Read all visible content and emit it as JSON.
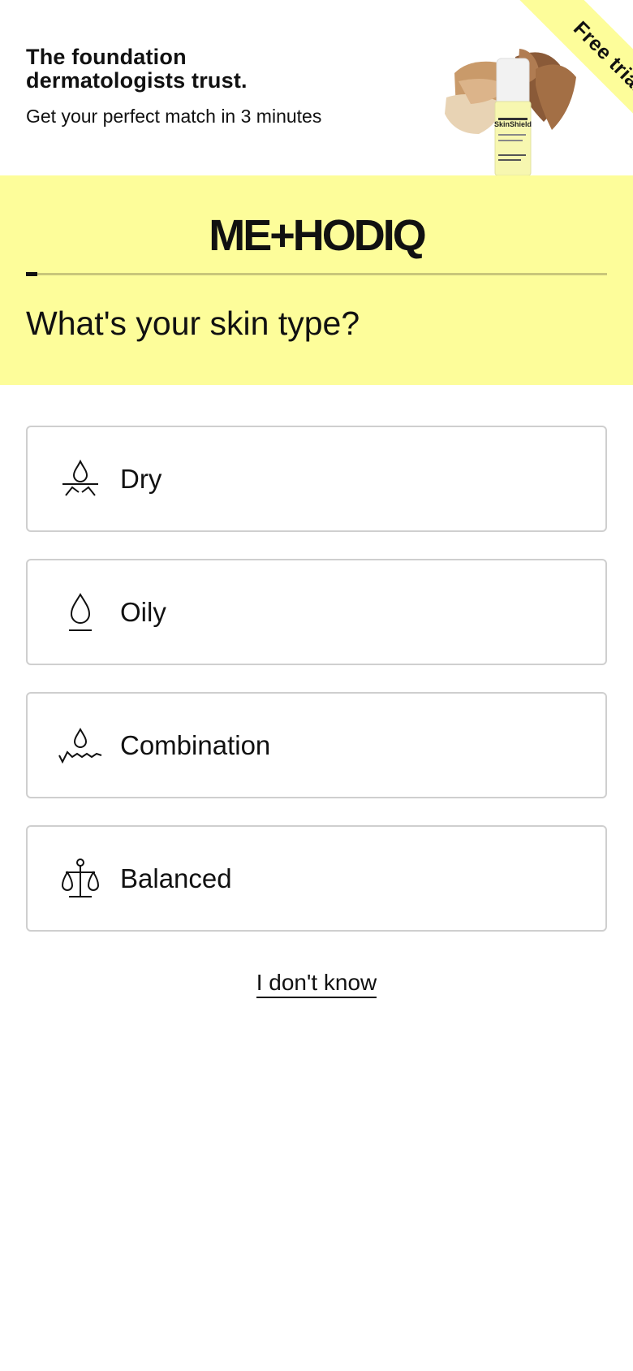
{
  "hero": {
    "title_line1": "The foundation",
    "title_line2": "dermatologists trust.",
    "subtitle": "Get your perfect match in 3 minutes",
    "ribbon": "Free trial",
    "product_name": "SkinShield"
  },
  "brand": {
    "logo": "ME+HODIQ",
    "accent": "#fdfd9a"
  },
  "progress": {
    "fraction": 0.02
  },
  "question": "What's your skin type?",
  "options": [
    {
      "label": "Dry",
      "icon": "dry-skin-icon"
    },
    {
      "label": "Oily",
      "icon": "oily-skin-icon"
    },
    {
      "label": "Combination",
      "icon": "combination-skin-icon"
    },
    {
      "label": "Balanced",
      "icon": "balanced-skin-icon"
    }
  ],
  "dont_know": "I don't know"
}
